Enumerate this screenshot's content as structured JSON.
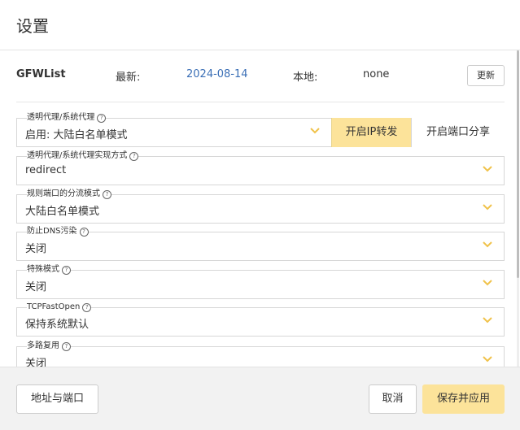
{
  "dialog": {
    "title": "设置"
  },
  "gfwlist": {
    "label": "GFWList",
    "latest_label": "最新:",
    "latest_value": "2024-08-14",
    "local_label": "本地:",
    "local_value": "none",
    "update_label": "更新"
  },
  "fields": {
    "proxy": {
      "label": "透明代理/系统代理",
      "value": "启用: 大陆白名单模式",
      "ip_forward_label": "开启IP转发",
      "port_share_label": "开启端口分享"
    },
    "impl": {
      "label": "透明代理/系统代理实现方式",
      "value": "redirect"
    },
    "routing": {
      "label": "规则端口的分流模式",
      "value": "大陆白名单模式"
    },
    "dns": {
      "label": "防止DNS污染",
      "value": "关闭"
    },
    "special": {
      "label": "特殊模式",
      "value": "关闭"
    },
    "tfo": {
      "label": "TCPFastOpen",
      "value": "保持系统默认"
    },
    "mux": {
      "label": "多路复用",
      "value": "关闭"
    }
  },
  "footer": {
    "address_label": "地址与端口",
    "cancel_label": "取消",
    "save_label": "保存并应用"
  },
  "colors": {
    "accent": "#fce39a",
    "chevron": "#f0c24a",
    "link": "#3b6fb6"
  },
  "icons": {
    "help": "help-circle-icon",
    "dropdown": "chevron-down-icon"
  }
}
